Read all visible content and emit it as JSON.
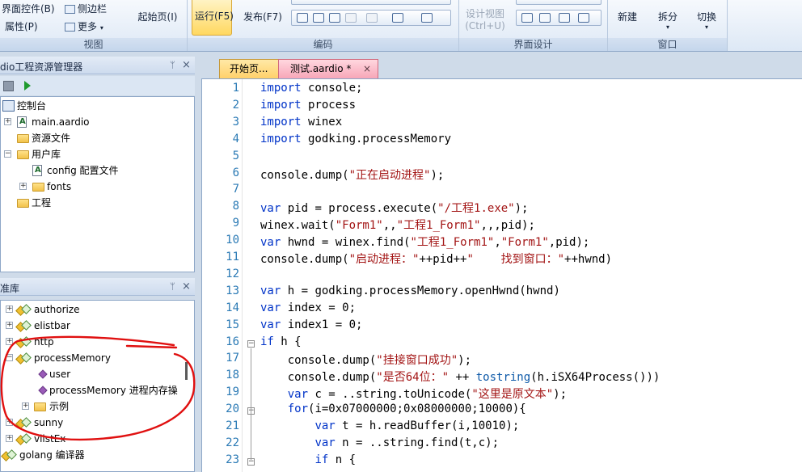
{
  "ribbon": {
    "view": {
      "interface_controls": "界面控件(B)",
      "sidebar": "侧边栏",
      "properties": "属性(P)",
      "more": "更多",
      "start_page": "起始页(I)",
      "label": "视图"
    },
    "coding": {
      "run": "运行(F5)",
      "publish": "发布(F7)",
      "label": "编码"
    },
    "design": {
      "design_view": "设计视图",
      "design_view_shortcut": "(Ctrl+U)",
      "label": "界面设计"
    },
    "window": {
      "new": "新建",
      "split": "拆分",
      "switch": "切换",
      "label": "窗口"
    }
  },
  "project_panel": {
    "title": "dio工程资源管理器",
    "pin": "ᛘ",
    "close": "×",
    "nodes": {
      "console": "控制台",
      "main": "main.aardio",
      "resources": "资源文件",
      "userlib": "用户库",
      "config": "config 配置文件",
      "fonts": "fonts",
      "project": "工程"
    }
  },
  "lib_panel": {
    "title": "准库",
    "pin": "ᛘ",
    "close": "×",
    "nodes": {
      "authorize": "authorize",
      "elistbar": "elistbar",
      "http": "http",
      "processMemory": "processMemory",
      "user": "user",
      "processMemory_item": "processMemory 进程内存操",
      "example": "示例",
      "sunny": "sunny",
      "vlistEx": "vlistEx",
      "golang": "golang 编译器"
    }
  },
  "tabs": {
    "start": "开始页...",
    "active": "测试.aardio *",
    "close": "×"
  },
  "editor": {
    "line_numbers": [
      "1",
      "2",
      "3",
      "4",
      "5",
      "6",
      "7",
      "8",
      "9",
      "10",
      "11",
      "12",
      "13",
      "14",
      "15",
      "16",
      "17",
      "18",
      "19",
      "20",
      "21",
      "22",
      "23"
    ],
    "fold_glyph": "⊟",
    "lines": [
      "import console;",
      "import process",
      "import winex",
      "import godking.processMemory",
      "",
      "console.dump(\"正在启动进程\");",
      "",
      "var pid = process.execute(\"/工程1.exe\");",
      "winex.wait(\"Form1\",,\"工程1_Form1\",,,pid);",
      "var hwnd = winex.find(\"工程1_Form1\",\"Form1\",pid);",
      "console.dump(\"启动进程：\"++pid++\"    找到窗口：\"++hwnd)",
      "",
      "var h = godking.processMemory.openHwnd(hwnd)",
      "var index = 0;",
      "var index1 = 0;",
      "if h {",
      "    console.dump(\"挂接窗口成功\");",
      "    console.dump(\"是否64位：\" ++ tostring(h.iSX64Process()))",
      "    var c = ..string.toUnicode(\"这里是原文本\");",
      "    for(i=0x07000000;0x08000000;10000){",
      "        var t = h.readBuffer(i,10010);",
      "        var n = ..string.find(t,c);",
      "        if n {"
    ]
  },
  "colors": {
    "annotation": "#e01010",
    "keyword": "#0033c8",
    "string": "#a31515",
    "line_number": "#2b7ab5"
  }
}
